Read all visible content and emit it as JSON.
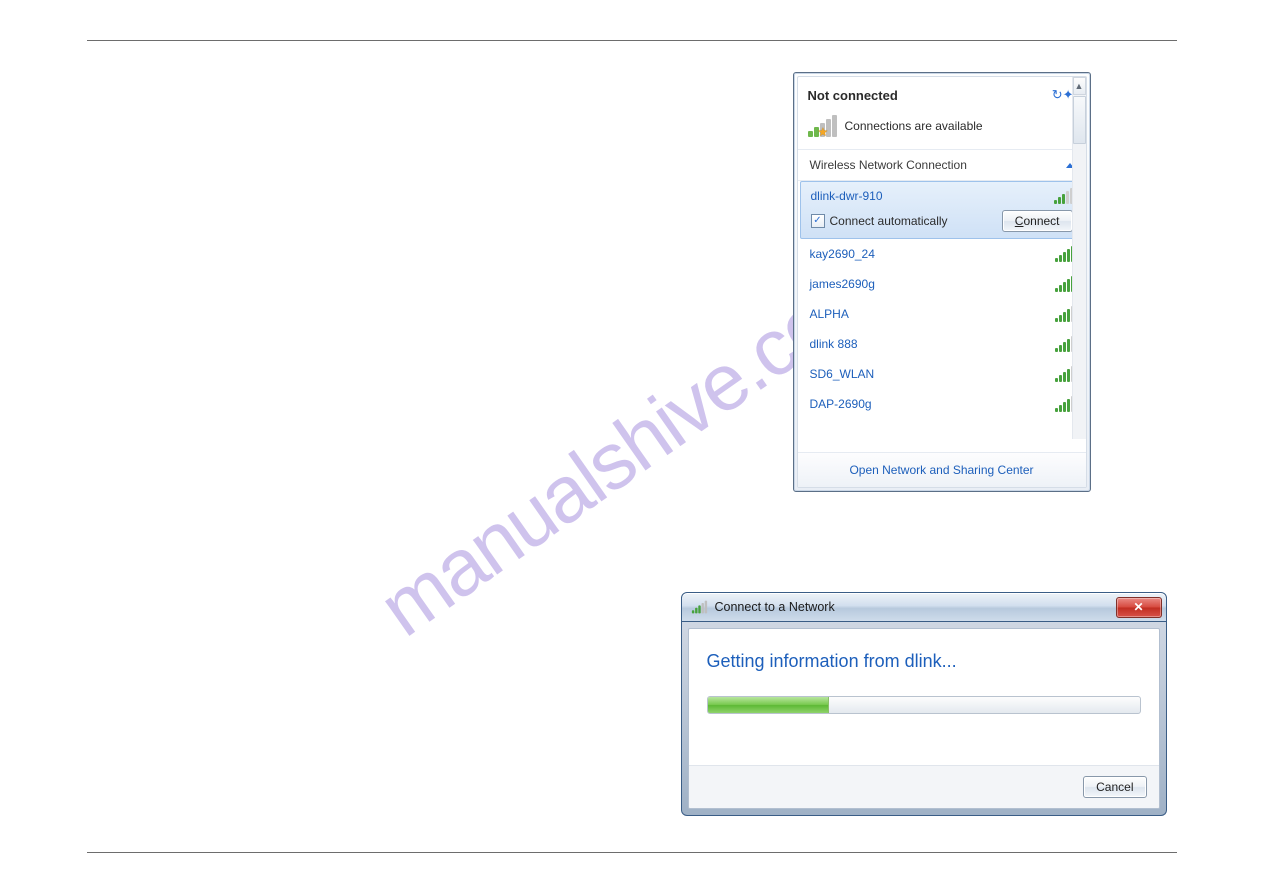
{
  "watermark": "manualshive.com",
  "wifi": {
    "status_title": "Not connected",
    "connections_msg": "Connections are available",
    "section_label": "Wireless Network Connection",
    "auto_connect_label": "Connect automatically",
    "connect_btn": "Connect",
    "footer_link": "Open Network and Sharing Center",
    "selected_network": "dlink-dwr-910",
    "networks": [
      {
        "name": "kay2690_24",
        "strength": 5
      },
      {
        "name": "james2690g",
        "strength": 5
      },
      {
        "name": "ALPHA",
        "strength": 4
      },
      {
        "name": "dlink 888",
        "strength": 4
      },
      {
        "name": "SD6_WLAN",
        "strength": 4
      },
      {
        "name": "DAP-2690g",
        "strength": 4
      }
    ]
  },
  "dialog": {
    "title": "Connect to a Network",
    "message": "Getting information from dlink...",
    "cancel_btn": "Cancel"
  }
}
